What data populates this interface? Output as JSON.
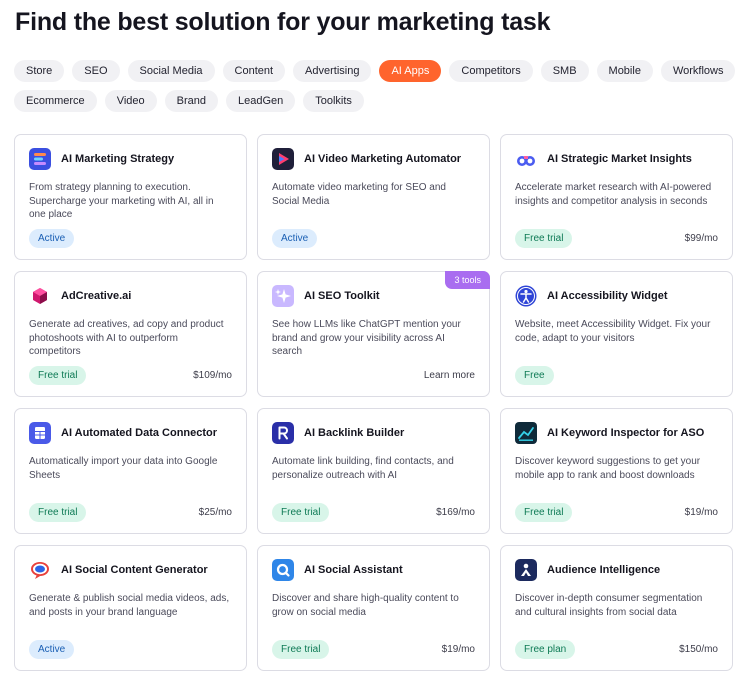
{
  "page": {
    "title": "Find the best solution for your marketing task"
  },
  "filters": {
    "row1": [
      "Store",
      "SEO",
      "Social Media",
      "Content",
      "Advertising",
      "AI Apps",
      "Competitors",
      "SMB",
      "Mobile",
      "Workflows"
    ],
    "row2": [
      "Ecommerce",
      "Video",
      "Brand",
      "LeadGen",
      "Toolkits"
    ],
    "selected": "AI Apps"
  },
  "colors": {
    "accent": "#ff642d",
    "active_badge_bg": "#dcecfd",
    "trial_badge_bg": "#d8f5e9",
    "ribbon": "#a96df0"
  },
  "cards": [
    {
      "title": "AI Marketing Strategy",
      "description": "From strategy planning to execution. Supercharge your marketing with AI, all in one place",
      "badge": "Active",
      "price": "",
      "icon": "strategy-stack-icon"
    },
    {
      "title": "AI Video Marketing Automator",
      "description": "Automate video marketing for SEO and Social Media",
      "badge": "Active",
      "price": "",
      "icon": "video-play-icon"
    },
    {
      "title": "AI Strategic Market Insights",
      "description": "Accelerate market research with AI-powered insights and competitor analysis in seconds",
      "badge": "Free trial",
      "price": "$99/mo",
      "icon": "binoculars-icon"
    },
    {
      "title": "AdCreative.ai",
      "description": "Generate ad creatives, ad copy and product photoshoots with AI to outperform competitors",
      "badge": "Free trial",
      "price": "$109/mo",
      "icon": "adcreative-cube-icon"
    },
    {
      "title": "AI SEO Toolkit",
      "description": "See how LLMs like ChatGPT mention your brand and grow your visibility across AI search",
      "badge": "",
      "price": "",
      "link": "Learn more",
      "ribbon": "3 tools",
      "icon": "sparkle-icon"
    },
    {
      "title": "AI Accessibility Widget",
      "description": "Website, meet Accessibility Widget. Fix your code, adapt to your visitors",
      "badge": "Free",
      "price": "",
      "icon": "accessibility-person-icon"
    },
    {
      "title": "AI Automated Data Connector",
      "description": "Automatically import your data into Google Sheets",
      "badge": "Free trial",
      "price": "$25/mo",
      "icon": "sheets-icon"
    },
    {
      "title": "AI Backlink Builder",
      "description": "Automate link building, find contacts, and personalize outreach with AI",
      "badge": "Free trial",
      "price": "$169/mo",
      "icon": "letter-r-icon"
    },
    {
      "title": "AI Keyword Inspector for ASO",
      "description": "Discover keyword suggestions to get your mobile app to rank and boost downloads",
      "badge": "Free trial",
      "price": "$19/mo",
      "icon": "keyword-chart-icon"
    },
    {
      "title": "AI Social Content Generator",
      "description": "Generate & publish social media videos, ads, and posts in your brand language",
      "badge": "Active",
      "price": "",
      "icon": "chat-bubble-icon"
    },
    {
      "title": "AI Social Assistant",
      "description": "Discover and share high-quality content to grow on social media",
      "badge": "Free trial",
      "price": "$19/mo",
      "icon": "search-circle-icon"
    },
    {
      "title": "Audience Intelligence",
      "description": "Discover in-depth consumer segmentation and cultural insights from social data",
      "badge": "Free plan",
      "price": "$150/mo",
      "icon": "audience-person-icon"
    }
  ]
}
